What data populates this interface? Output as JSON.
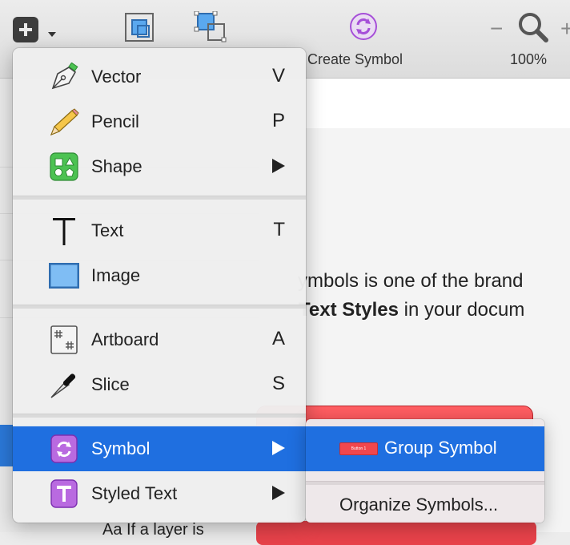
{
  "toolbar": {
    "create_symbol_label": "Create Symbol",
    "zoom_value": "100%",
    "zoom_minus": "−",
    "zoom_plus": "+"
  },
  "canvas": {
    "text_line1": "ymbols is one of the brand",
    "text_line2_bold": "Text Styles",
    "text_line2_rest": " in your docum"
  },
  "sidebar": {
    "bottom_text": "Aa   If a layer is"
  },
  "menu": {
    "items": [
      {
        "label": "Vector",
        "shortcut": "V",
        "icon": "pen-icon"
      },
      {
        "label": "Pencil",
        "shortcut": "P",
        "icon": "pencil-icon"
      },
      {
        "label": "Shape",
        "shortcut": "",
        "icon": "shape-icon",
        "has_submenu": true
      },
      {
        "label": "Text",
        "shortcut": "T",
        "icon": "text-icon"
      },
      {
        "label": "Image",
        "shortcut": "",
        "icon": "image-icon"
      },
      {
        "label": "Artboard",
        "shortcut": "A",
        "icon": "artboard-icon"
      },
      {
        "label": "Slice",
        "shortcut": "S",
        "icon": "knife-icon"
      },
      {
        "label": "Symbol",
        "shortcut": "",
        "icon": "symbol-icon",
        "has_submenu": true,
        "selected": true
      },
      {
        "label": "Styled Text",
        "shortcut": "",
        "icon": "styled-text-icon",
        "has_submenu": true
      }
    ]
  },
  "submenu": {
    "items": [
      {
        "label": "Group Symbol",
        "preview_text": "Button 1",
        "selected": true
      },
      {
        "label": "Organize Symbols..."
      }
    ]
  },
  "colors": {
    "highlight": "#1f6fe0",
    "symbol_purple": "#a64fd8",
    "shape_green": "#4cc252",
    "button_red": "#f0474d"
  }
}
